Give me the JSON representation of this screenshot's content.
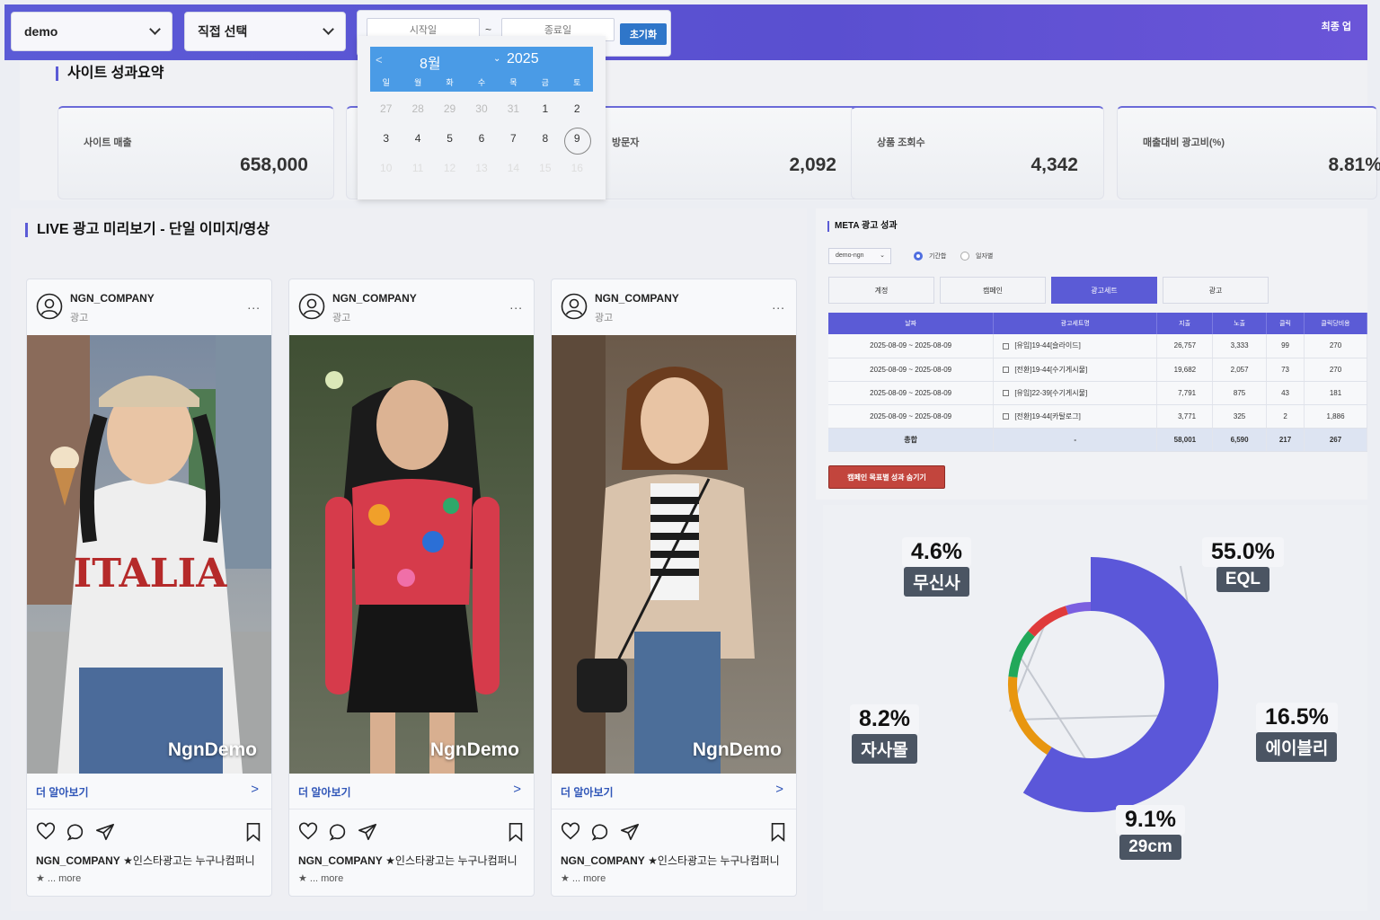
{
  "topbar": {
    "account_select": "demo",
    "direct_select": "직접 선택",
    "start_placeholder": "시작일",
    "end_placeholder": "종료일",
    "tilde": "~",
    "reset_label": "초기화",
    "last_update": "최종 업"
  },
  "calendar": {
    "prev": "<",
    "month": "8월",
    "year_chevron": "⌄",
    "year": "2025",
    "weekdays": [
      "일",
      "월",
      "화",
      "수",
      "목",
      "금",
      "토"
    ],
    "rows": [
      [
        "27",
        "28",
        "29",
        "30",
        "31",
        "1",
        "2"
      ],
      [
        "3",
        "4",
        "5",
        "6",
        "7",
        "8",
        "9"
      ],
      [
        "10",
        "11",
        "12",
        "13",
        "14",
        "15",
        "16"
      ]
    ],
    "selected_day": "9"
  },
  "summary": {
    "title": "사이트 성과요약",
    "stats": [
      {
        "label": "사이트 매출",
        "value": "658,000"
      },
      {
        "label": "",
        "value": ""
      },
      {
        "label": "방문자",
        "value": "2,092"
      },
      {
        "label": "상품 조회수",
        "value": "4,342"
      },
      {
        "label": "매출대비 광고비(%)",
        "value": "8.81%"
      }
    ]
  },
  "live": {
    "title": "LIVE 광고 미리보기 - 단일 이미지/영상",
    "cards": [
      {
        "account": "NGN_COMPANY",
        "sub": "광고",
        "more": "...",
        "watermark": "NgnDemo",
        "learn_more": "더 알아보기",
        "chevron": ">",
        "caption_account": "NGN_COMPANY",
        "caption_text": "★인스타광고는 누구나컴퍼니",
        "caption_more": "★ ... more"
      },
      {
        "account": "NGN_COMPANY",
        "sub": "광고",
        "more": "...",
        "watermark": "NgnDemo",
        "learn_more": "더 알아보기",
        "chevron": ">",
        "caption_account": "NGN_COMPANY",
        "caption_text": "★인스타광고는 누구나컴퍼니",
        "caption_more": "★ ... more"
      },
      {
        "account": "NGN_COMPANY",
        "sub": "광고",
        "more": "...",
        "watermark": "NgnDemo",
        "learn_more": "더 알아보기",
        "chevron": ">",
        "caption_account": "NGN_COMPANY",
        "caption_text": "★인스타광고는 누구나컴퍼니",
        "caption_more": "★ ... more"
      }
    ]
  },
  "meta": {
    "title": "META 광고 성과",
    "account_select": "demo-ngn",
    "select_chevron": "⌄",
    "radio_period": "기간합",
    "radio_daily": "일자별",
    "tabs": [
      "계정",
      "캠페인",
      "광고세트",
      "광고"
    ],
    "active_tab": 2,
    "columns": [
      "날짜",
      "광고세트명",
      "지출",
      "노출",
      "클릭",
      "클릭당비용"
    ],
    "rows": [
      [
        "2025-08-09 ~ 2025-08-09",
        "[유입]19-44[슬라이드]",
        "26,757",
        "3,333",
        "99",
        "270"
      ],
      [
        "2025-08-09 ~ 2025-08-09",
        "[전환]19-44[수기게시물]",
        "19,682",
        "2,057",
        "73",
        "270"
      ],
      [
        "2025-08-09 ~ 2025-08-09",
        "[유입]22-39[수기게시물]",
        "7,791",
        "875",
        "43",
        "181"
      ],
      [
        "2025-08-09 ~ 2025-08-09",
        "[전환]19-44[카탈로그]",
        "3,771",
        "325",
        "2",
        "1,886"
      ]
    ],
    "total": [
      "총합",
      "-",
      "58,001",
      "6,590",
      "217",
      "267"
    ],
    "hide_button": "캠페인 목표별 성과 숨기기"
  },
  "chart_data": {
    "type": "pie",
    "variant": "donut",
    "series": [
      {
        "name": "EQL",
        "value": 55.0,
        "pct_label": "55.0%",
        "color": "#5b57d9"
      },
      {
        "name": "에이블리",
        "value": 16.5,
        "pct_label": "16.5%",
        "color": "#e8960f"
      },
      {
        "name": "29cm",
        "value": 9.1,
        "pct_label": "9.1%",
        "color": "#22a85a"
      },
      {
        "name": "자사몰",
        "value": 8.2,
        "pct_label": "8.2%",
        "color": "#df3b3b"
      },
      {
        "name": "무신사",
        "value": 4.6,
        "pct_label": "4.6%",
        "color": "#7b5fe0"
      }
    ]
  },
  "colors": {
    "accent": "#5b5bd6",
    "reset_button": "#2f76c9",
    "hide_button": "#c2453d",
    "calendar_header": "#4a9be6"
  },
  "icons": [
    "chevron-down-icon",
    "user-circle-icon",
    "heart-icon",
    "comment-icon",
    "send-icon",
    "bookmark-icon",
    "chevron-right-icon",
    "chevron-left-icon"
  ]
}
